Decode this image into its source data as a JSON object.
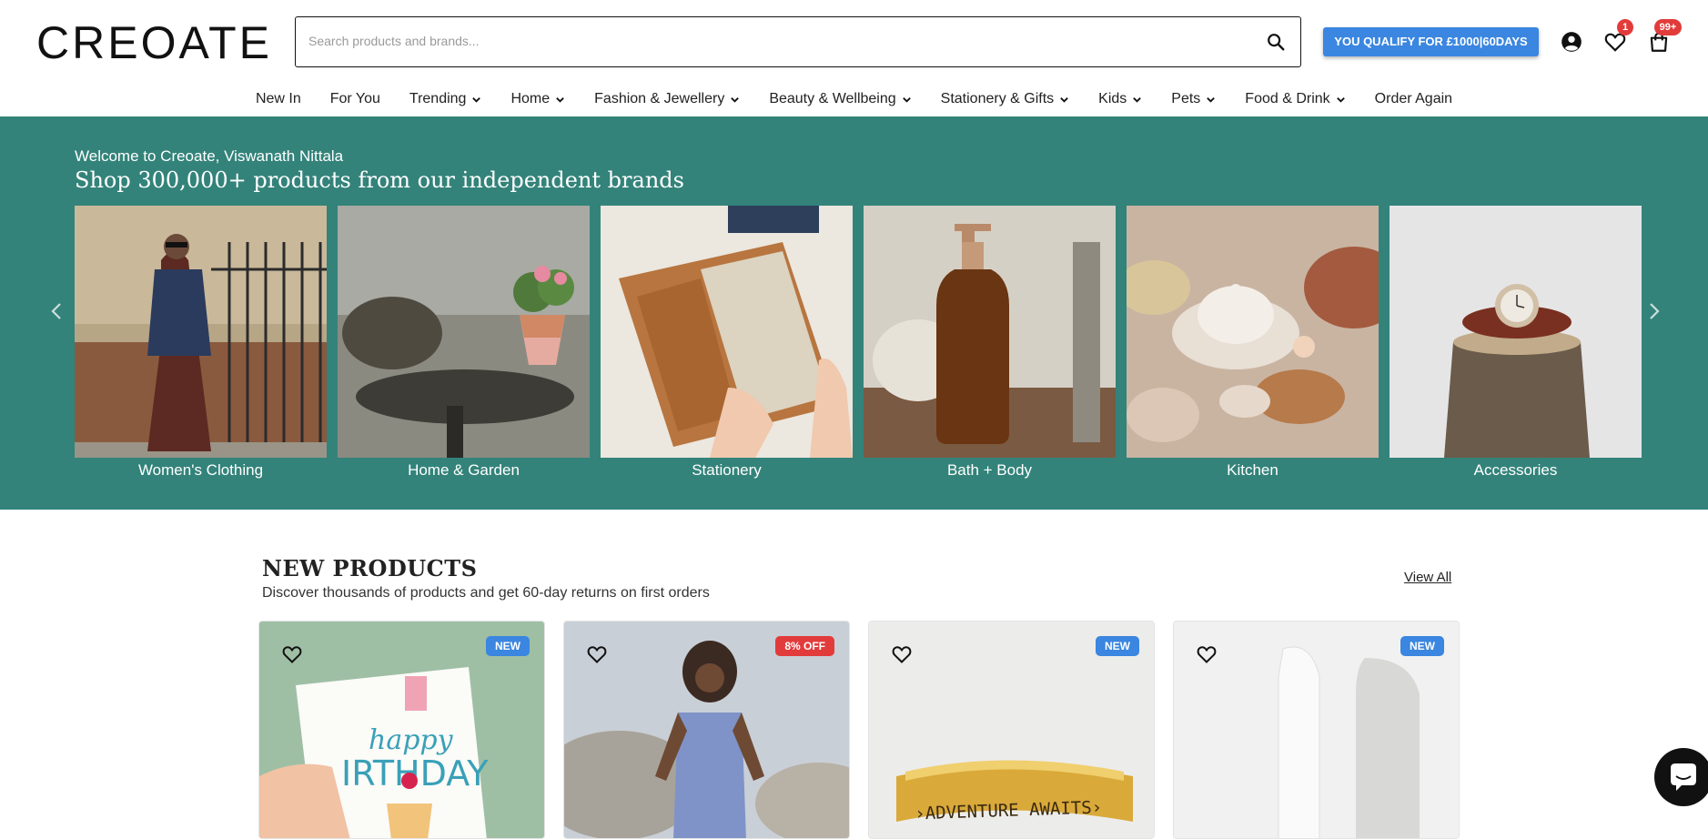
{
  "header": {
    "logo": "CREOATE",
    "search_placeholder": "Search products and brands...",
    "promo_label": "YOU QUALIFY FOR £1000|60DAYS",
    "wishlist_count": "1",
    "cart_count": "99+"
  },
  "nav": {
    "items": [
      {
        "label": "New In",
        "dropdown": false
      },
      {
        "label": "For You",
        "dropdown": false
      },
      {
        "label": "Trending",
        "dropdown": true
      },
      {
        "label": "Home",
        "dropdown": true
      },
      {
        "label": "Fashion & Jewellery",
        "dropdown": true
      },
      {
        "label": "Beauty & Wellbeing",
        "dropdown": true
      },
      {
        "label": "Stationery & Gifts",
        "dropdown": true
      },
      {
        "label": "Kids",
        "dropdown": true
      },
      {
        "label": "Pets",
        "dropdown": true
      },
      {
        "label": "Food & Drink",
        "dropdown": true
      },
      {
        "label": "Order Again",
        "dropdown": false
      }
    ]
  },
  "hero": {
    "welcome": "Welcome to Creoate, Viswanath Nittala",
    "title": "Shop 300,000+ products from our independent brands",
    "background": "#33837a",
    "categories": [
      {
        "label": "Women's Clothing"
      },
      {
        "label": "Home & Garden"
      },
      {
        "label": "Stationery"
      },
      {
        "label": "Bath + Body"
      },
      {
        "label": "Kitchen"
      },
      {
        "label": "Accessories"
      }
    ]
  },
  "new_products": {
    "title": "NEW PRODUCTS",
    "subtitle": "Discover thousands of products and get 60-day returns on first orders",
    "view_all": "View All",
    "cards": [
      {
        "tag": "NEW",
        "tag_color": "#3a86e0"
      },
      {
        "tag": "8% OFF",
        "tag_color": "#e23b3b"
      },
      {
        "tag": "NEW",
        "tag_color": "#3a86e0"
      },
      {
        "tag": "NEW",
        "tag_color": "#3a86e0"
      }
    ]
  }
}
